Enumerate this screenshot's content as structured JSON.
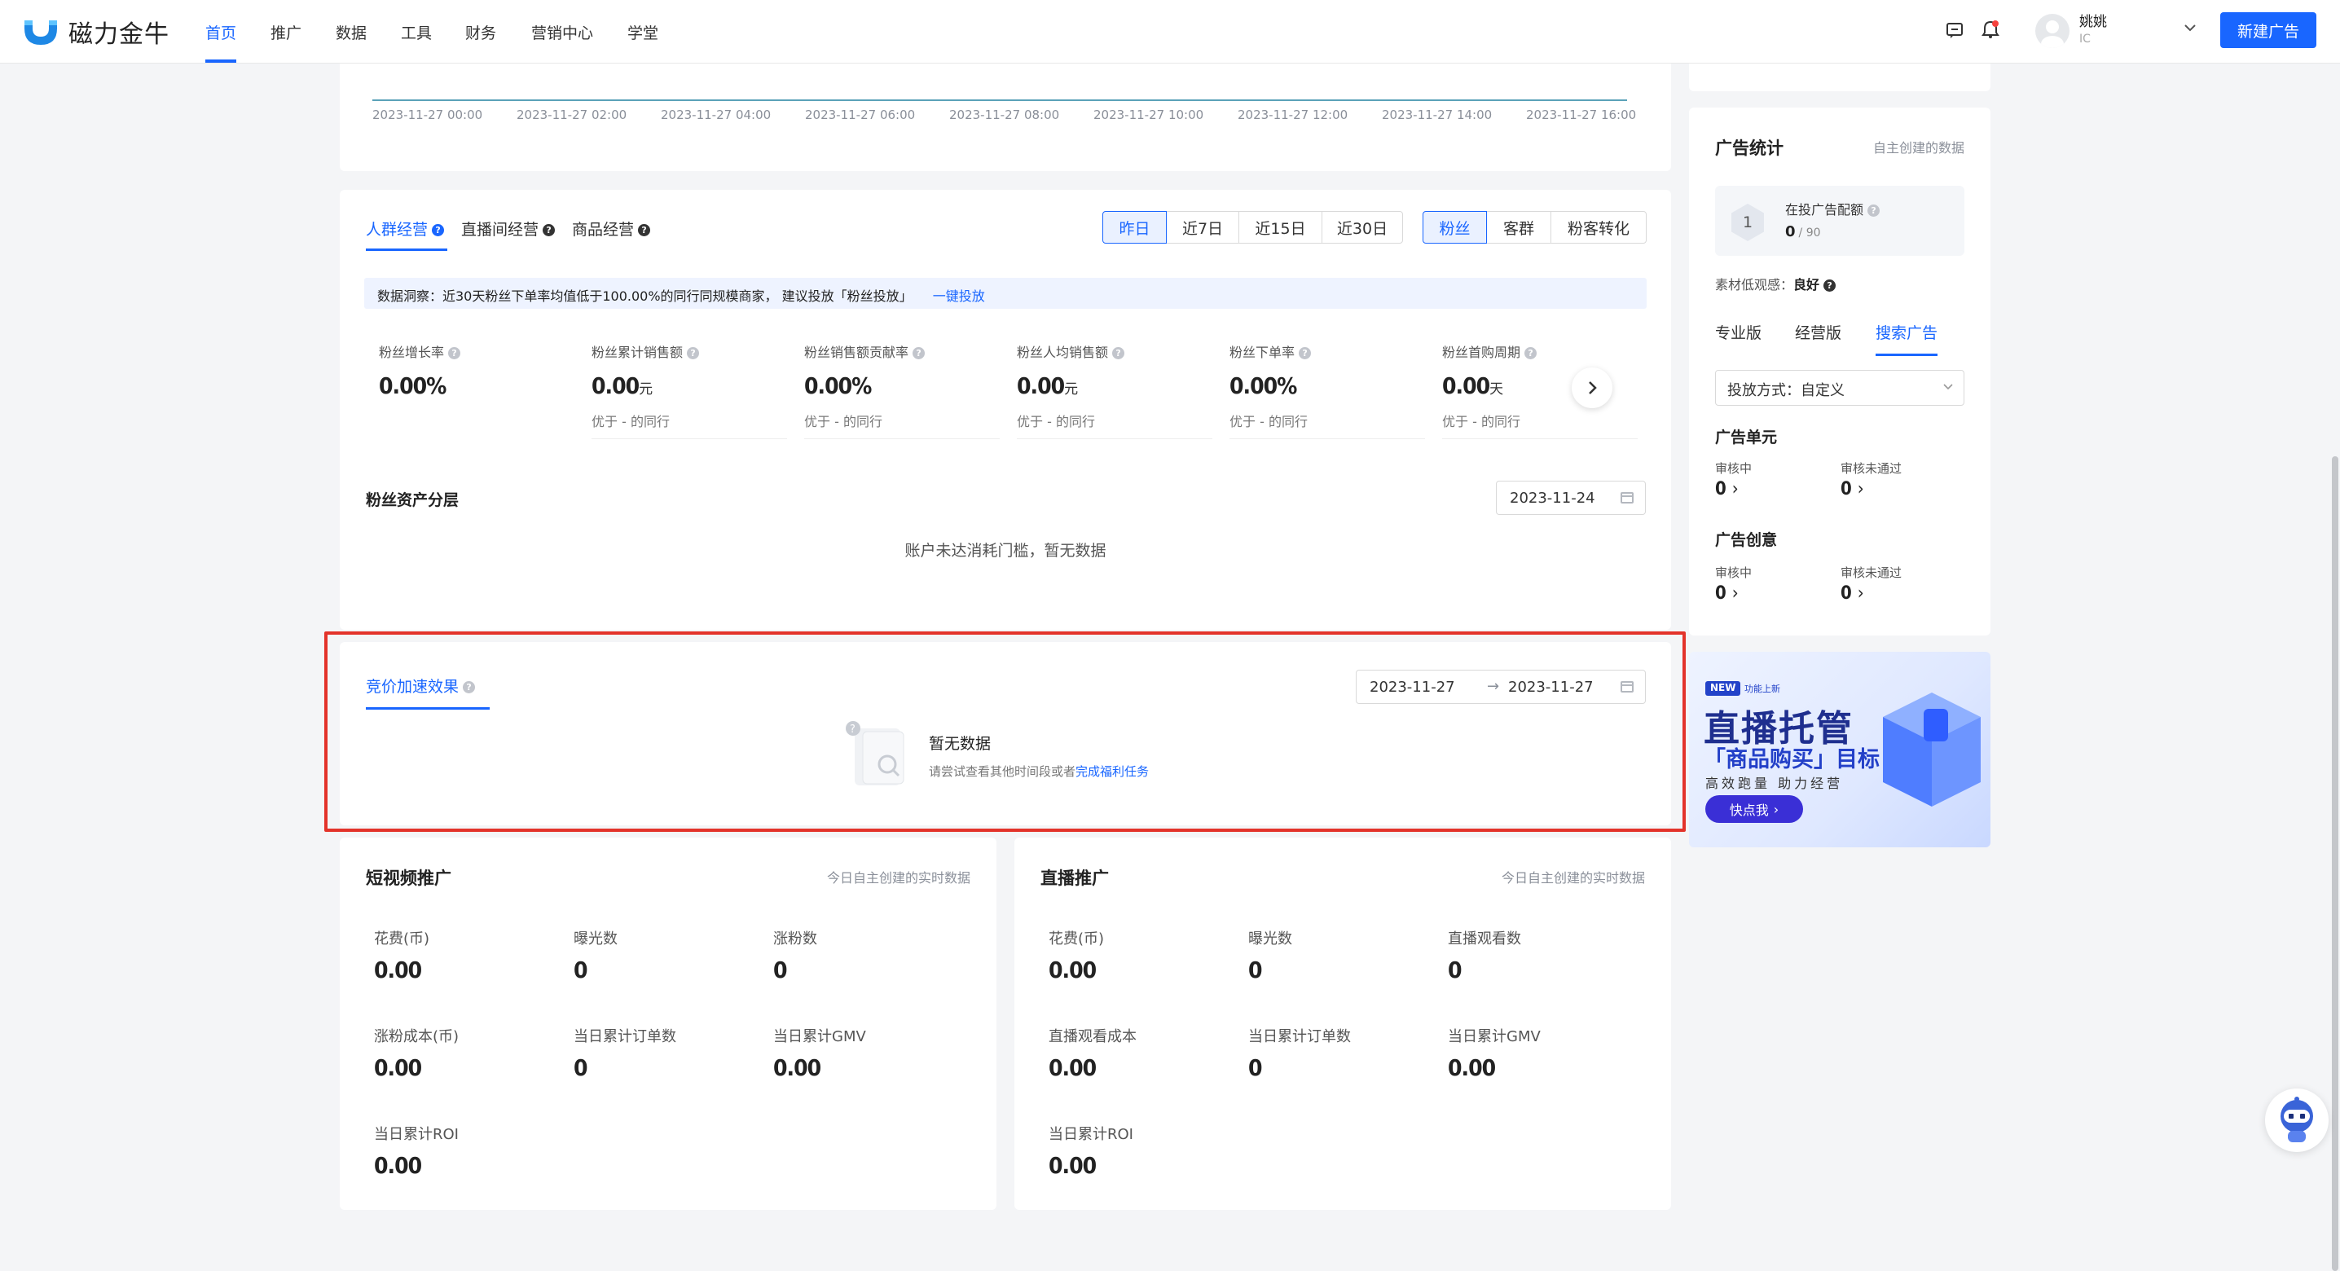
{
  "header": {
    "brand": "磁力金牛",
    "nav": [
      "首页",
      "推广",
      "数据",
      "工具",
      "财务",
      "营销中心",
      "学堂"
    ],
    "user_name": "姚姚",
    "user_id": "IC",
    "new_ad_button": "新建广告"
  },
  "trend_chart": {
    "x_ticks": [
      "2023-11-27 00:00",
      "2023-11-27 02:00",
      "2023-11-27 04:00",
      "2023-11-27 06:00",
      "2023-11-27 08:00",
      "2023-11-27 10:00",
      "2023-11-27 12:00",
      "2023-11-27 14:00",
      "2023-11-27 16:00"
    ]
  },
  "ops": {
    "tabs": [
      "人群经营",
      "直播间经营",
      "商品经营"
    ],
    "period_buttons": [
      "昨日",
      "近7日",
      "近15日",
      "近30日"
    ],
    "audience_buttons": [
      "粉丝",
      "客群",
      "粉客转化"
    ],
    "insight_text": "数据洞察：近30天粉丝下单率均值低于100.00%的同行同规模商家， 建议投放「粉丝投放」",
    "insight_link": "一键投放",
    "metrics": [
      {
        "label": "粉丝增长率",
        "value": "0.00%",
        "unit": "",
        "compare": ""
      },
      {
        "label": "粉丝累计销售额",
        "value": "0.00",
        "unit": "元",
        "compare": "优于 - 的同行"
      },
      {
        "label": "粉丝销售额贡献率",
        "value": "0.00%",
        "unit": "",
        "compare": "优于 - 的同行"
      },
      {
        "label": "粉丝人均销售额",
        "value": "0.00",
        "unit": "元",
        "compare": "优于 - 的同行"
      },
      {
        "label": "粉丝下单率",
        "value": "0.00%",
        "unit": "",
        "compare": "优于 - 的同行"
      },
      {
        "label": "粉丝首购周期",
        "value": "0.00",
        "unit": "天",
        "compare": "优于 - 的同行"
      }
    ],
    "fan_assets_title": "粉丝资产分层",
    "fan_assets_date": "2023-11-24",
    "fan_assets_empty": "账户未达消耗门槛，暂无数据"
  },
  "bid": {
    "tab": "竞价加速效果",
    "date_start": "2023-11-27",
    "date_end": "2023-11-27",
    "empty_title": "暂无数据",
    "empty_hint": "请尝试查看其他时间段或者",
    "empty_link": "完成福利任务"
  },
  "short_video": {
    "title": "短视频推广",
    "note": "今日自主创建的实时数据",
    "metrics": [
      {
        "label": "花费(币)",
        "value": "0.00"
      },
      {
        "label": "曝光数",
        "value": "0"
      },
      {
        "label": "涨粉数",
        "value": "0"
      },
      {
        "label": "涨粉成本(币)",
        "value": "0.00"
      },
      {
        "label": "当日累计订单数",
        "value": "0"
      },
      {
        "label": "当日累计GMV",
        "value": "0.00"
      },
      {
        "label": "当日累计ROI",
        "value": "0.00"
      }
    ]
  },
  "live": {
    "title": "直播推广",
    "note": "今日自主创建的实时数据",
    "metrics": [
      {
        "label": "花费(币)",
        "value": "0.00"
      },
      {
        "label": "曝光数",
        "value": "0"
      },
      {
        "label": "直播观看数",
        "value": "0"
      },
      {
        "label": "直播观看成本",
        "value": "0.00"
      },
      {
        "label": "当日累计订单数",
        "value": "0"
      },
      {
        "label": "当日累计GMV",
        "value": "0.00"
      },
      {
        "label": "当日累计ROI",
        "value": "0.00"
      }
    ]
  },
  "ad_stats": {
    "title": "广告统计",
    "note": "自主创建的数据",
    "quota_icon": "1",
    "quota_label": "在投广告配额",
    "quota_value": "0",
    "quota_total": "/ 90",
    "material_label": "素材低观感：",
    "material_value": "良好",
    "tabs": [
      "专业版",
      "经营版",
      "搜索广告"
    ],
    "delivery_select": "投放方式：自定义",
    "unit_title": "广告单元",
    "creative_title": "广告创意",
    "reviewing_label": "审核中",
    "rejected_label": "审核未通过",
    "unit_reviewing": "0",
    "unit_rejected": "0",
    "creative_reviewing": "0",
    "creative_rejected": "0"
  },
  "banner": {
    "badge_new": "NEW",
    "badge_tag": "功能上新",
    "title": "直播托管",
    "subtitle": "「商品购买」目标",
    "slogan": "高效跑量  助力经营",
    "cta": "快点我"
  },
  "colors": {
    "primary": "#1966ff",
    "highlight_border": "#e3332a"
  }
}
